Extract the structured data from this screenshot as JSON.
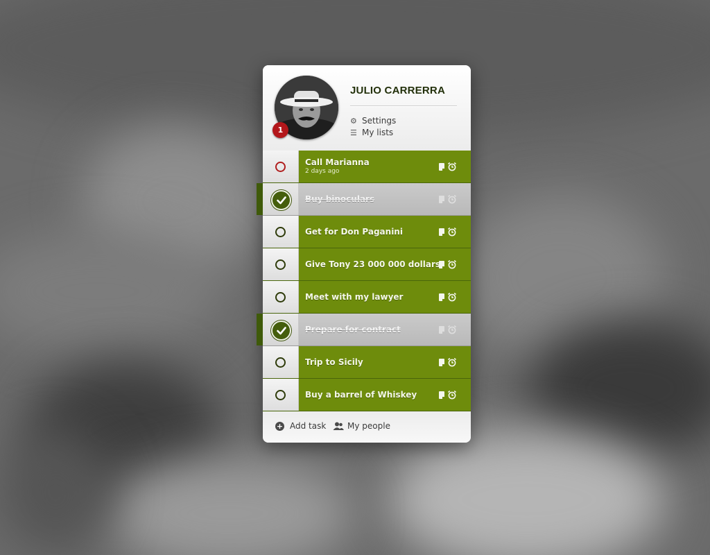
{
  "profile": {
    "name": "JULIO CARRERRA",
    "badge_count": "1",
    "menu": [
      {
        "label": "Settings",
        "icon": "gear-icon"
      },
      {
        "label": "My lists",
        "icon": "list-icon"
      }
    ]
  },
  "tasks": [
    {
      "title": "Call Marianna",
      "subtitle": "2 days ago",
      "done": false,
      "urgent": true
    },
    {
      "title": "Buy binoculars",
      "done": true
    },
    {
      "title": "Get for Don Paganini",
      "done": false
    },
    {
      "title": "Give Tony 23 000 000 dollars",
      "done": false
    },
    {
      "title": "Meet with my lawyer",
      "done": false
    },
    {
      "title": "Prepare for contract",
      "done": true
    },
    {
      "title": "Trip to Sicily",
      "done": false
    },
    {
      "title": "Buy a barrel of Whiskey",
      "done": false
    }
  ],
  "footer": {
    "add_task": "Add task",
    "my_people": "My people"
  },
  "colors": {
    "accent_green": "#6e8c0c",
    "done_gray": "#c2c2c2",
    "badge_red": "#b3171b"
  }
}
